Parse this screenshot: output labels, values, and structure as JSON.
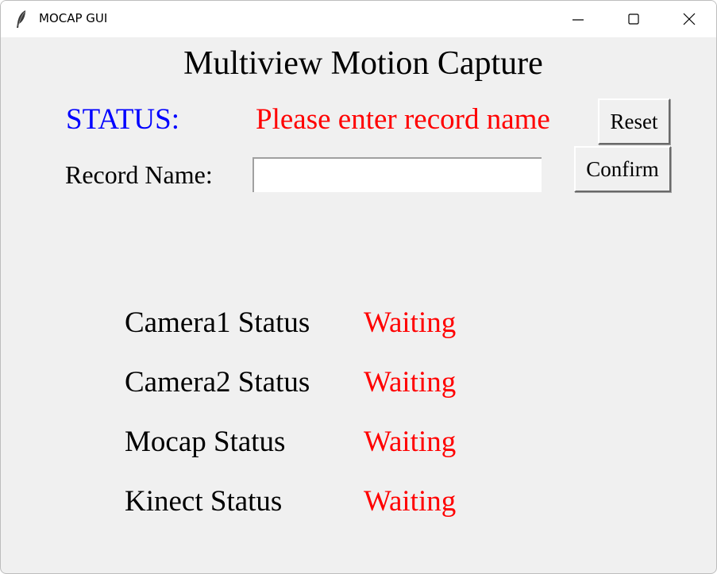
{
  "window": {
    "title": "MOCAP GUI",
    "icon": "feather-icon",
    "controls": [
      "minimize-icon",
      "maximize-icon",
      "close-icon"
    ]
  },
  "header": {
    "title": "Multiview Motion Capture"
  },
  "status": {
    "label": "STATUS:",
    "message": "Please enter record name",
    "label_color": "#0000ff",
    "message_color": "#ff0000"
  },
  "record": {
    "label": "Record Name:",
    "value": "",
    "placeholder": ""
  },
  "buttons": {
    "reset": "Reset",
    "confirm": "Confirm"
  },
  "devices": [
    {
      "name": "Camera1 Status",
      "status": "Waiting"
    },
    {
      "name": "Camera2 Status",
      "status": "Waiting"
    },
    {
      "name": "Mocap Status",
      "status": "Waiting"
    },
    {
      "name": "Kinect Status",
      "status": "Waiting"
    }
  ],
  "colors": {
    "background": "#f0f0f0",
    "waiting": "#ff0000"
  }
}
